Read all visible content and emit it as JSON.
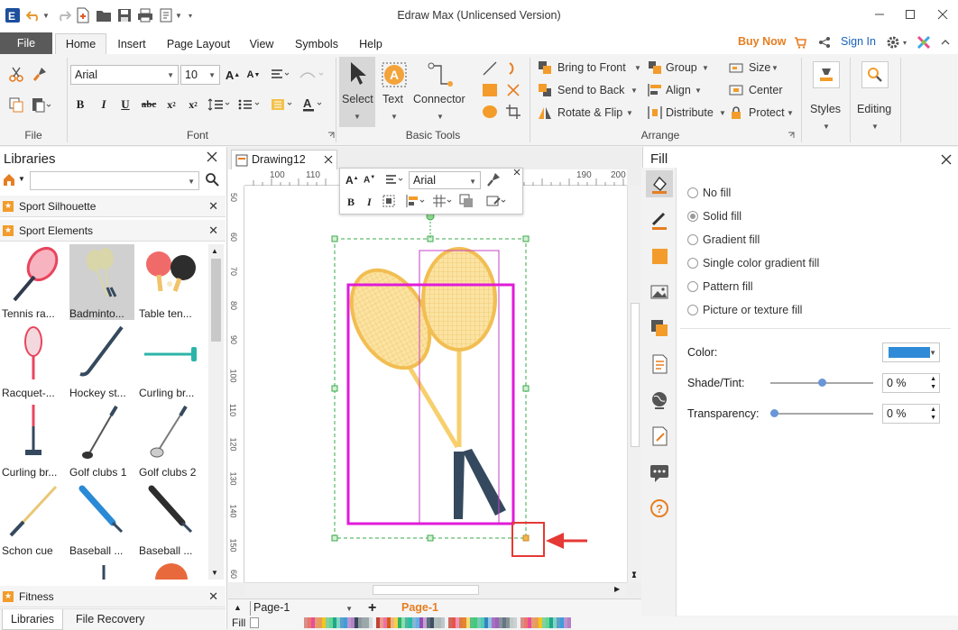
{
  "window": {
    "title": "Edraw Max (Unlicensed Version)"
  },
  "menu": {
    "file": "File",
    "tabs": [
      "Home",
      "Insert",
      "Page Layout",
      "View",
      "Symbols",
      "Help"
    ],
    "active_tab": "Home",
    "buy_now": "Buy Now",
    "sign_in": "Sign In"
  },
  "ribbon": {
    "groups": {
      "file": "File",
      "font": "Font",
      "basic_tools": "Basic Tools",
      "arrange": "Arrange"
    },
    "font_name": "Arial",
    "font_size": "10",
    "tools": {
      "select": "Select",
      "text": "Text",
      "connector": "Connector"
    },
    "arrange": {
      "bring_to_front": "Bring to Front",
      "send_to_back": "Send to Back",
      "rotate_flip": "Rotate & Flip",
      "group": "Group",
      "align": "Align",
      "distribute": "Distribute",
      "size": "Size",
      "center": "Center",
      "protect": "Protect"
    },
    "styles": "Styles",
    "editing": "Editing"
  },
  "libraries": {
    "title": "Libraries",
    "search_value": "",
    "sections": [
      {
        "name": "Sport Silhouette"
      },
      {
        "name": "Sport Elements"
      },
      {
        "name": "Fitness"
      }
    ],
    "shapes": [
      "Tennis ra...",
      "Badminto...",
      "Table ten...",
      "Racquet-...",
      "Hockey st...",
      "Curling br...",
      "Curling br...",
      "Golf clubs 1",
      "Golf clubs 2",
      "Schon cue",
      "Baseball ...",
      "Baseball ..."
    ],
    "bottom_tabs": [
      "Libraries",
      "File Recovery"
    ]
  },
  "document": {
    "tab": "Drawing12",
    "ruler_top": [
      "100",
      "110",
      "190",
      "200"
    ],
    "ruler_left": [
      "50",
      "60",
      "70",
      "80",
      "90",
      "100",
      "110",
      "120",
      "130",
      "140",
      "150",
      "60"
    ],
    "floating_toolbar": {
      "font": "Arial"
    }
  },
  "pages": {
    "selector": "Page-1",
    "active": "Page-1"
  },
  "fill_bar_label": "Fill",
  "fill_panel": {
    "title": "Fill",
    "options": [
      "No fill",
      "Solid fill",
      "Gradient fill",
      "Single color gradient fill",
      "Pattern fill",
      "Picture or texture fill"
    ],
    "selected": "Solid fill",
    "color_label": "Color:",
    "color_value": "#2f8bd8",
    "shade_label": "Shade/Tint:",
    "shade_value": "0 %",
    "shade_level": 0.5,
    "transparency_label": "Transparency:",
    "transparency_value": "0 %",
    "transparency_level": 0
  },
  "colors": {
    "accent": "#2b7bd5",
    "buy_now": "#e67e22",
    "selection": "#e01bd8",
    "racket": "#f7cf6d",
    "handle": "#35495e",
    "highlight_box": "#e53935"
  }
}
